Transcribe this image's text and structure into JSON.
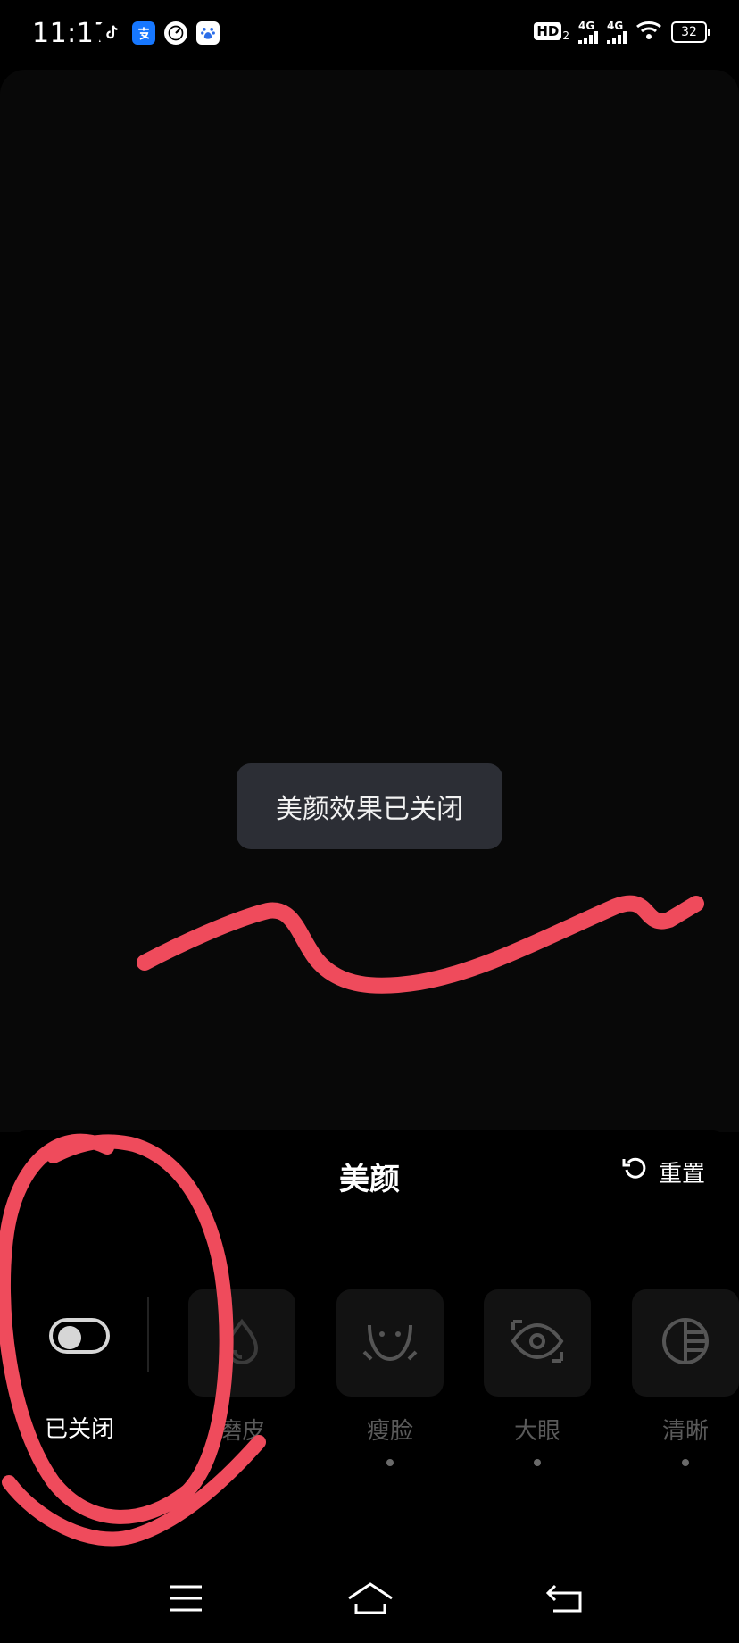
{
  "status_bar": {
    "time": "11:17",
    "app_icons": [
      "tiktok-icon",
      "alipay-icon",
      "speed-icon",
      "baidu-icon"
    ],
    "hd_label": "HD",
    "hd_sub": "2",
    "sim1_label": "4G",
    "sim2_label": "4G",
    "battery_level": "32"
  },
  "toast": {
    "text": "美颜效果已关闭"
  },
  "panel": {
    "title": "美颜",
    "reset_label": "重置",
    "toggle": {
      "label": "已关闭",
      "state": "off"
    },
    "features": [
      {
        "label": "磨皮",
        "icon": "drop-icon",
        "dot": false
      },
      {
        "label": "瘦脸",
        "icon": "face-slim-icon",
        "dot": true
      },
      {
        "label": "大眼",
        "icon": "eye-icon",
        "dot": true
      },
      {
        "label": "清晰",
        "icon": "clarity-icon",
        "dot": true
      }
    ]
  },
  "navigation": {
    "icons": [
      "menu-icon",
      "home-icon",
      "back-icon"
    ]
  },
  "colors": {
    "annotation": "#ef4b5c",
    "toast_bg": "#2c2e35",
    "tile_bg": "#121212"
  }
}
